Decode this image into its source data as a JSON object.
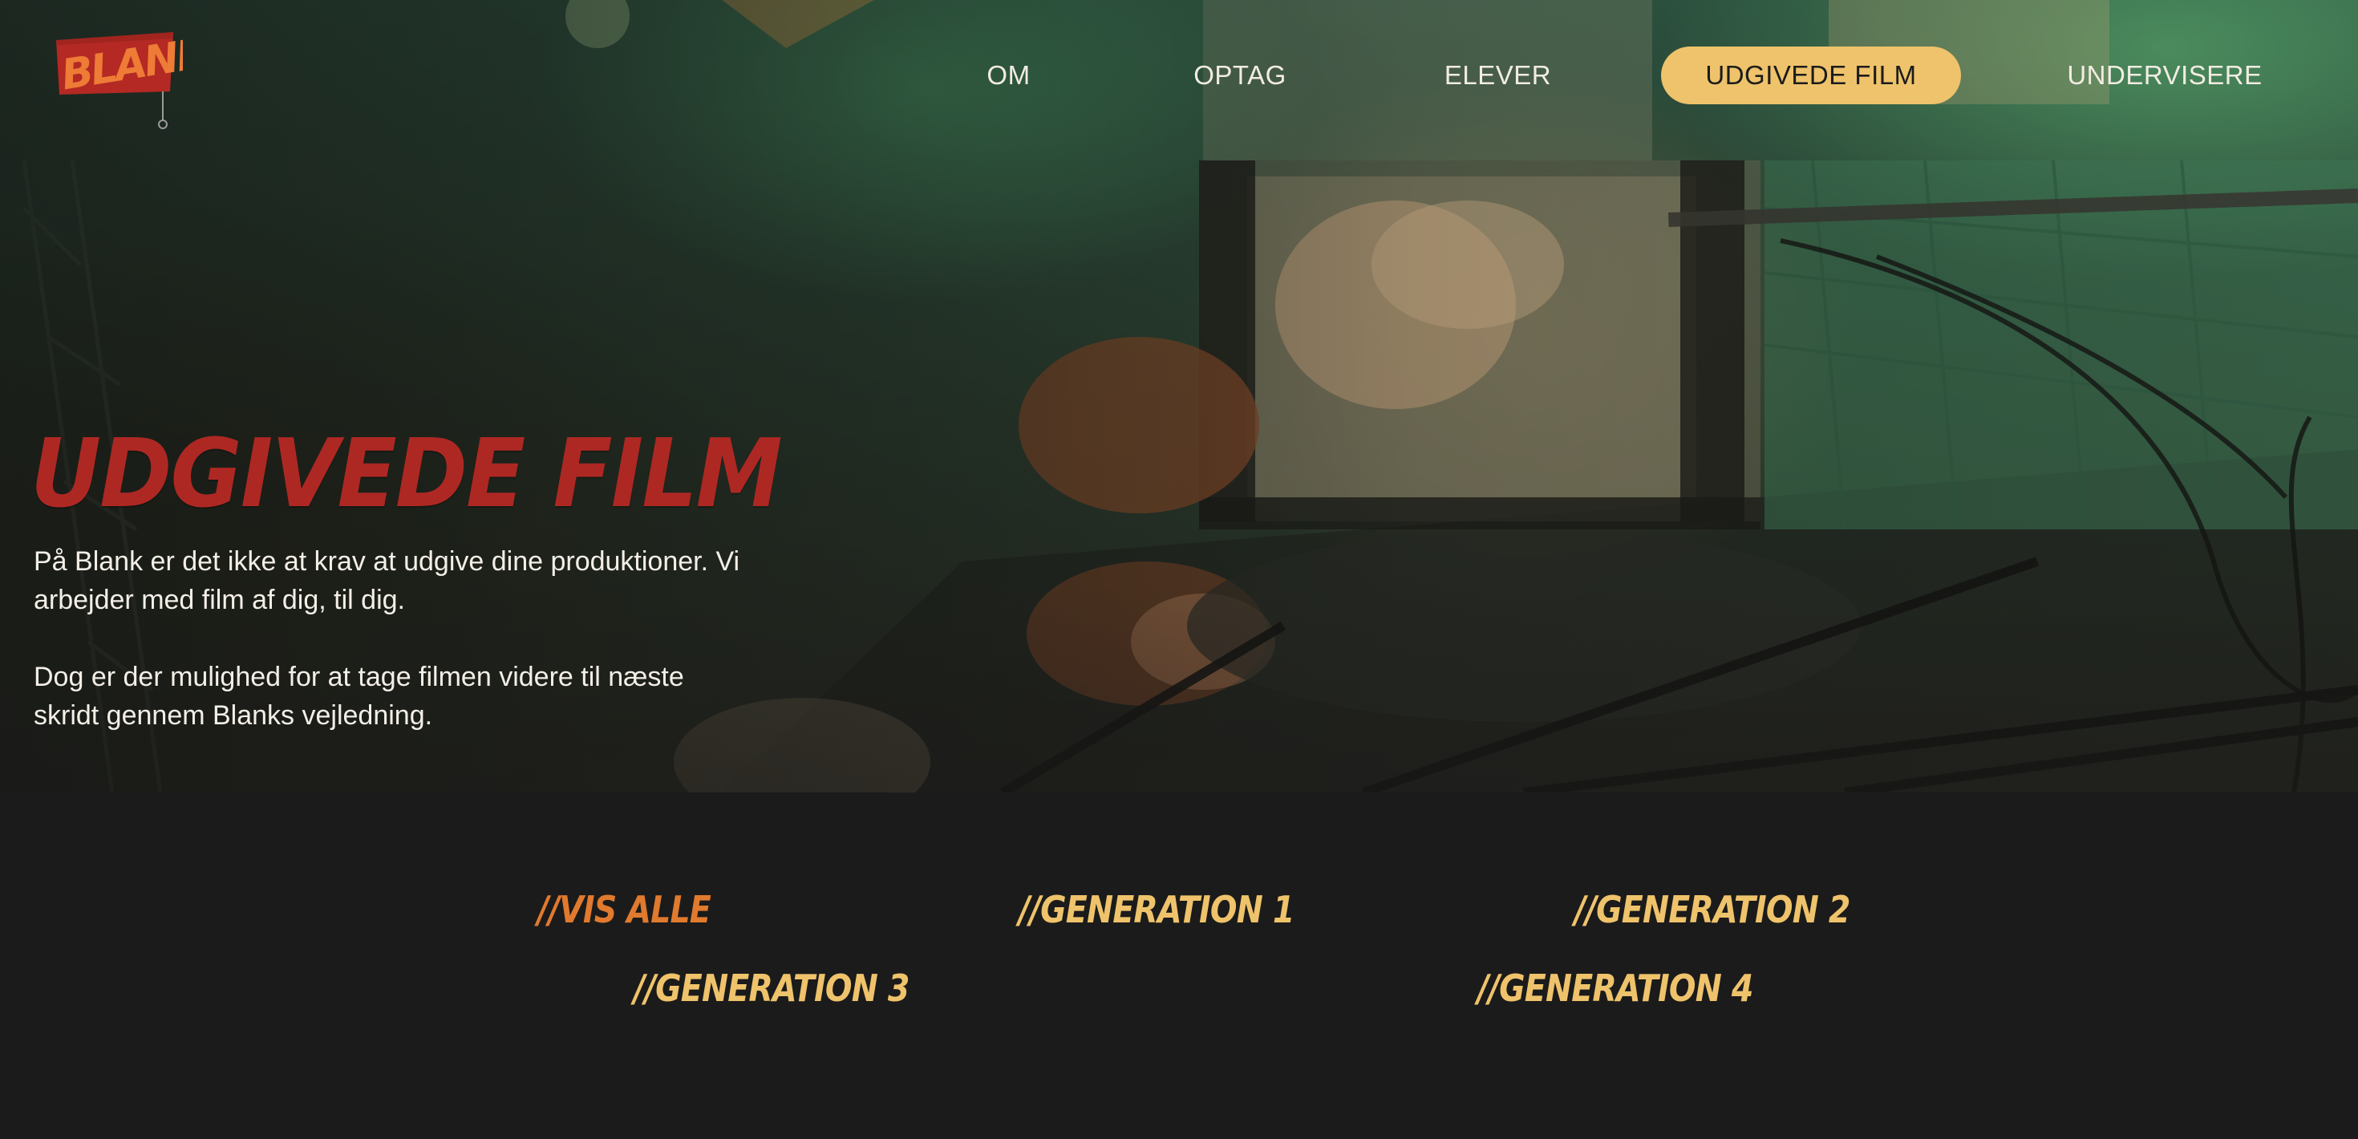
{
  "brand": {
    "logo_text": "BLANK"
  },
  "nav": {
    "items": [
      {
        "label": "OM"
      },
      {
        "label": "OPTAG"
      },
      {
        "label": "ELEVER"
      },
      {
        "label": "UDGIVEDE FILM",
        "active": true
      },
      {
        "label": "UNDERVISERE"
      }
    ]
  },
  "hero": {
    "title": "UDGIVEDE FILM",
    "paragraph_1": "På Blank er det ikke at krav at udgive dine produktioner. Vi arbejder med film af dig, til dig.",
    "paragraph_2": "Dog er der mulighed for at tage filmen videre til næste skridt gennem Blanks vejledning."
  },
  "filters": {
    "items": [
      {
        "label": "//VIS ALLE",
        "active": true
      },
      {
        "label": "//GENERATION 1"
      },
      {
        "label": "//GENERATION 2"
      },
      {
        "label": "//GENERATION 3"
      },
      {
        "label": "//GENERATION 4"
      }
    ]
  },
  "colors": {
    "accent_yellow": "#efc36b",
    "accent_orange": "#e07a2e",
    "title_red": "#ae2823",
    "background_dark": "#1b1b1b"
  }
}
